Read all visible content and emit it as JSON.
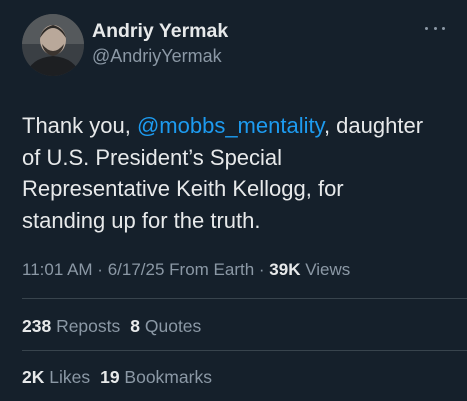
{
  "author": {
    "name": "Andriy Yermak",
    "handle": "@AndriyYermak"
  },
  "tweet": {
    "line1_pre": "Thank you, ",
    "mention": "@mobbs_mentality",
    "line1_post": ", daughter",
    "line2": "of U.S. President’s Special",
    "line3": "Representative Keith Kellogg, for",
    "line4": "standing up for the truth."
  },
  "meta": {
    "time": "11:01 AM",
    "sep1": " · ",
    "date": "6/17/25",
    "source": " From Earth",
    "sep2": " · ",
    "views_count": "39K",
    "views_label": " Views"
  },
  "stats": {
    "reposts_count": "238",
    "reposts_label": " Reposts",
    "quotes_count": "8",
    "quotes_label": " Quotes",
    "likes_count": "2K",
    "likes_label": " Likes",
    "bookmarks_count": "19",
    "bookmarks_label": " Bookmarks"
  },
  "colors": {
    "background": "#15202b",
    "text": "#e7e9ea",
    "secondary": "#8b98a5",
    "link": "#1d9bf0",
    "divider": "#38444d"
  },
  "icons": {
    "more": "more-horizontal-icon"
  }
}
